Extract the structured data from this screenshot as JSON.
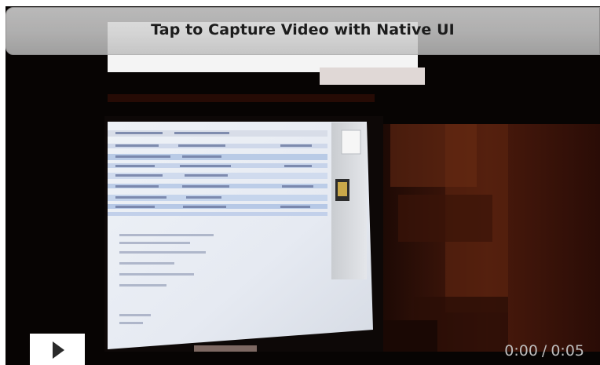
{
  "header": {
    "title": "Tap to Capture Video with Native UI"
  },
  "video": {
    "current_time": "0:00",
    "separator": "/",
    "duration": "0:05"
  },
  "controls": {
    "play_icon": "play-icon"
  },
  "colors": {
    "title_bar": "#cfcfcf",
    "title_text": "#1c1c1c",
    "video_background": "#070403",
    "time_text": "#bdbdbd"
  }
}
